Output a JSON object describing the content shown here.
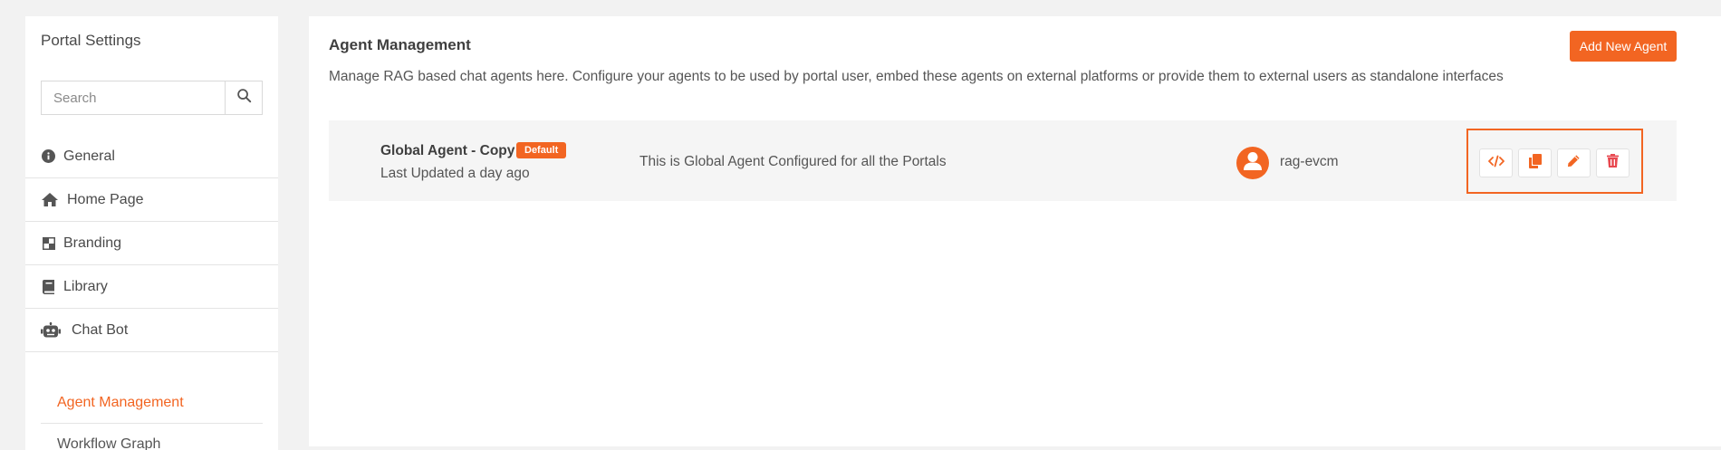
{
  "sidebar": {
    "title": "Portal Settings",
    "search": {
      "placeholder": "Search",
      "value": ""
    },
    "items": [
      {
        "label": "General",
        "icon": "info-circle-icon"
      },
      {
        "label": "Home Page",
        "icon": "home-icon"
      },
      {
        "label": "Branding",
        "icon": "branding-icon"
      },
      {
        "label": "Library",
        "icon": "book-icon"
      },
      {
        "label": "Chat Bot",
        "icon": "robot-icon"
      }
    ],
    "subitems": [
      {
        "label": "Agent Management",
        "active": true
      },
      {
        "label": "Workflow Graph",
        "active": false
      }
    ]
  },
  "main": {
    "title": "Agent Management",
    "description": "Manage RAG based chat agents here. Configure your agents to be used by portal user, embed these agents on external platforms or provide them to external users as standalone interfaces",
    "add_button": "Add New Agent",
    "agents": [
      {
        "name": "Global Agent - Copy",
        "badge": "Default",
        "updated": "Last Updated a day ago",
        "description": "This is Global Agent Configured for all the Portals",
        "owner": "rag-evcm",
        "actions": [
          "code-icon",
          "copy-icon",
          "pencil-icon",
          "trash-icon"
        ]
      }
    ]
  },
  "colors": {
    "accent": "#f26522",
    "background": "#f2f2f2",
    "panel": "#ffffff",
    "row": "#f5f5f5"
  }
}
